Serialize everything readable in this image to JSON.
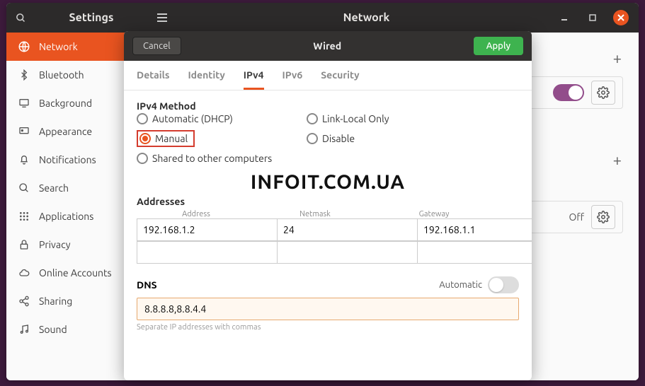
{
  "window": {
    "app_title": "Settings",
    "page_title": "Network"
  },
  "sidebar": {
    "items": [
      {
        "label": "Network",
        "icon": "network"
      },
      {
        "label": "Bluetooth",
        "icon": "bluetooth"
      },
      {
        "label": "Background",
        "icon": "display"
      },
      {
        "label": "Appearance",
        "icon": "appearance"
      },
      {
        "label": "Notifications",
        "icon": "bell"
      },
      {
        "label": "Search",
        "icon": "search"
      },
      {
        "label": "Applications",
        "icon": "grid"
      },
      {
        "label": "Privacy",
        "icon": "lock"
      },
      {
        "label": "Online Accounts",
        "icon": "cloud"
      },
      {
        "label": "Sharing",
        "icon": "share"
      },
      {
        "label": "Sound",
        "icon": "music"
      }
    ]
  },
  "content": {
    "off_label": "Off"
  },
  "dialog": {
    "cancel": "Cancel",
    "title": "Wired",
    "apply": "Apply",
    "tabs": [
      "Details",
      "Identity",
      "IPv4",
      "IPv6",
      "Security"
    ],
    "active_tab": "IPv4",
    "method_label": "IPv4 Method",
    "methods": {
      "auto": "Automatic (DHCP)",
      "link": "Link-Local Only",
      "manual": "Manual",
      "disable": "Disable",
      "shared": "Shared to other computers"
    },
    "selected_method": "manual",
    "watermark": "INFOIT.COM.UA",
    "addresses_label": "Addresses",
    "addr_headers": [
      "Address",
      "Netmask",
      "Gateway"
    ],
    "addr_rows": [
      {
        "address": "192.168.1.2",
        "netmask": "24",
        "gateway": "192.168.1.1"
      },
      {
        "address": "",
        "netmask": "",
        "gateway": ""
      }
    ],
    "dns_label": "DNS",
    "dns_auto_label": "Automatic",
    "dns_value": "8.8.8.8,8.8.4.4",
    "dns_hint": "Separate IP addresses with commas"
  }
}
